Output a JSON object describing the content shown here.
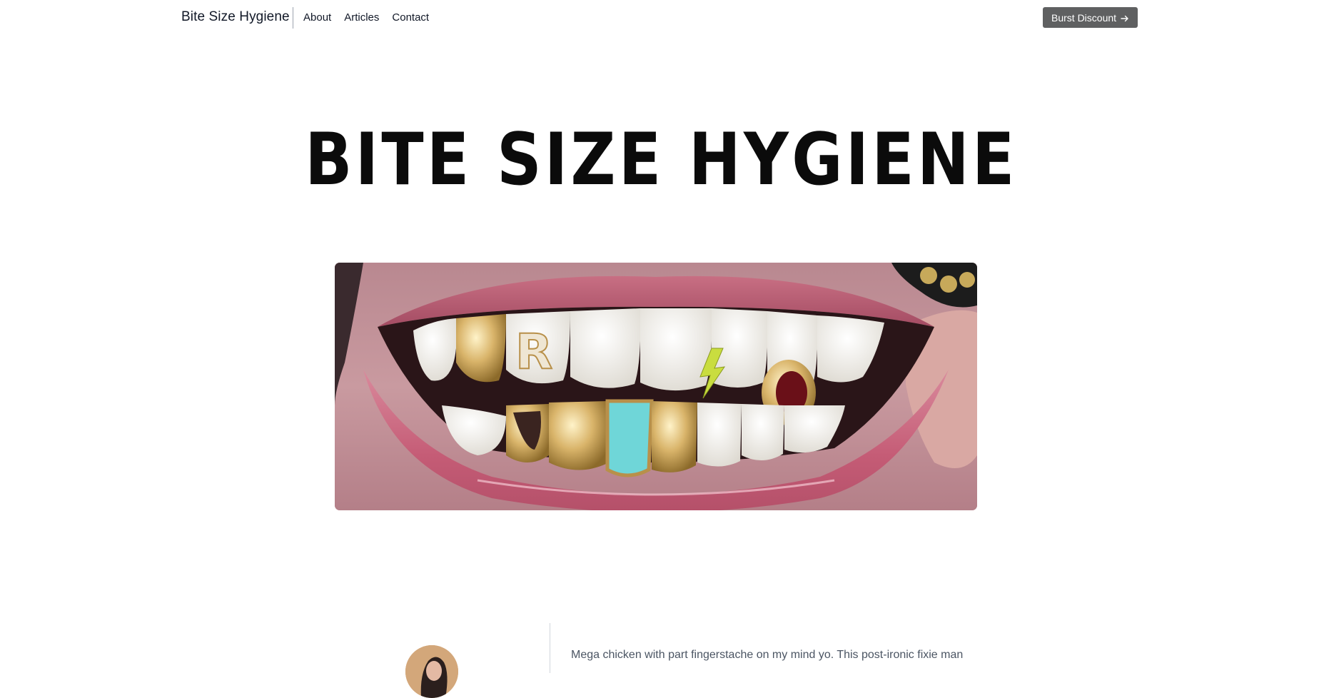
{
  "header": {
    "brand": "Bite Size Hygiene",
    "nav": [
      {
        "label": "About"
      },
      {
        "label": "Articles"
      },
      {
        "label": "Contact"
      }
    ],
    "cta_label": "Burst Discount",
    "cta_icon": "arrow-right-icon",
    "cta_color": "#5f6061"
  },
  "hero": {
    "title": "BITE SIZE HYGIENE",
    "image_alt": "Close-up of smiling mouth wearing decorative grills"
  },
  "intro": {
    "text": "Mega chicken with part fingerstache on my mind yo. This post-ironic fixie man"
  }
}
